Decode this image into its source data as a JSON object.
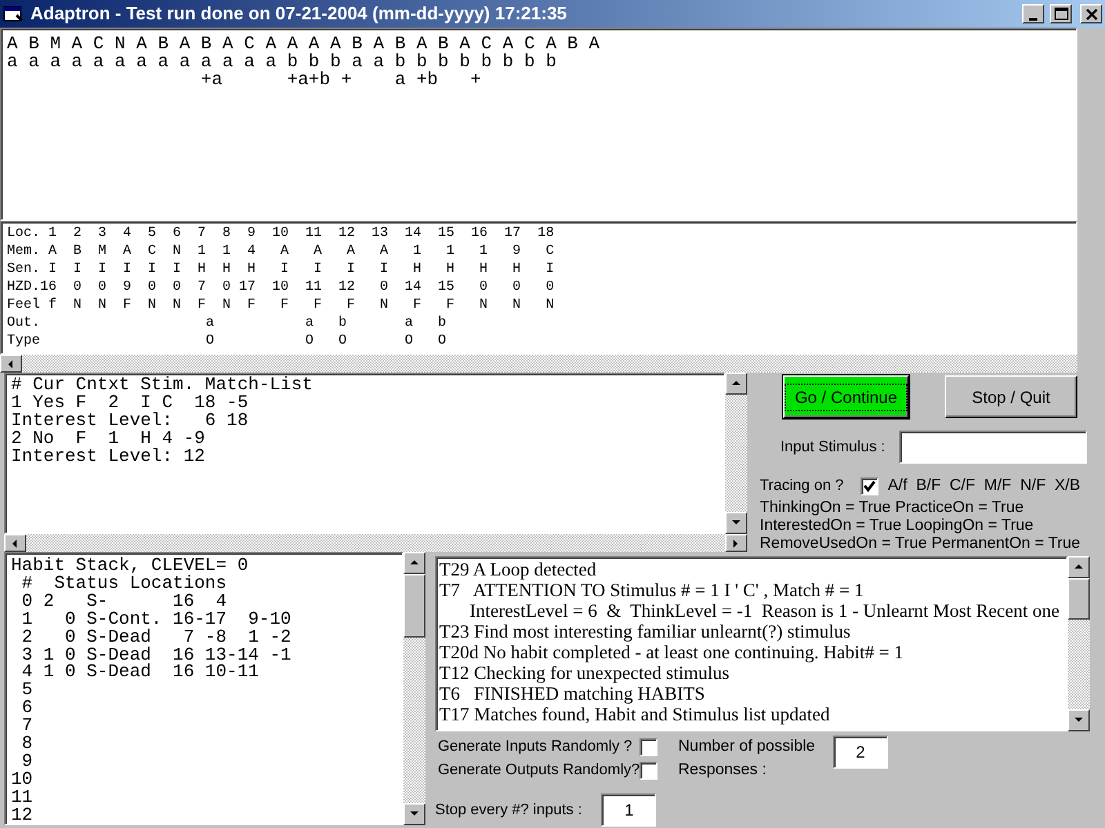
{
  "window": {
    "title": "Adaptron - Test run done on 07-21-2004 (mm-dd-yyyy) 17:21:35"
  },
  "sequence_panel": {
    "lines": [
      "A B M A C N A B A B A C A A A A B A B A B A C A C A B A",
      "a a a a a a a a a a a a a b b b a a b b b b b b b b",
      "                  +a      +a+b +    a +b   +"
    ]
  },
  "memory_panel": {
    "lines": [
      "Loc. 1  2  3  4  5  6  7  8  9  10  11  12  13  14  15  16  17  18",
      "Mem. A  B  M  A  C  N  1  1  4   A   A   A   A   1   1   1   9   C",
      "Sen. I  I  I  I  I  I  H  H  H   I   I   I   I   H   H   H   H   I",
      "HZD.16  0  0  9  0  0  7  0 17  10  11  12   0  14  15   0   0   0",
      "Feel f  N  N  F  N  N  F  N  F   F   F   F   N   F   F   N   N   N",
      "Out.                    a           a   b       a   b",
      "Type                    O           O   O       O   O"
    ]
  },
  "match_panel": {
    "lines": [
      "# Cur Cntxt Stim. Match-List",
      "1 Yes F  2  I C  18 -5",
      "Interest Level:   6 18",
      "2 No  F  1  H 4 -9",
      "Interest Level: 12"
    ]
  },
  "buttons": [
    {
      "label": "Go / Continue",
      "kind": "default"
    },
    {
      "label": "Stop / Quit",
      "kind": "normal"
    }
  ],
  "input_stimulus": {
    "label": "Input Stimulus :"
  },
  "tracing": {
    "label": "Tracing on ?",
    "checked": true,
    "codes": "A/f  B/F  C/F  M/F  N/F  X/B"
  },
  "flags": [
    "ThinkingOn = True PracticeOn = True",
    "InterestedOn = True LoopingOn = True",
    "RemoveUsedOn = True PermanentOn = True"
  ],
  "habit_panel": {
    "lines": [
      "Habit Stack, CLEVEL= 0",
      " #  Status Locations",
      " 0 2   S-      16  4",
      " 1   0 S-Cont. 16-17  9-10",
      " 2   0 S-Dead   7 -8  1 -2",
      " 3 1 0 S-Dead  16 13-14 -1",
      " 4 1 0 S-Dead  16 10-11",
      " 5",
      " 6",
      " 7",
      " 8",
      " 9",
      "10",
      "11",
      "12"
    ]
  },
  "trace_log": {
    "lines": [
      {
        "text": "T29 A Loop detected",
        "kind": "entry"
      },
      {
        "text": "T7   ATTENTION TO Stimulus # = 1 I ' C' , Match # = 1",
        "kind": "entry"
      },
      {
        "text": "InterestLevel = 6  &  ThinkLevel = -1  Reason is 1 - Unlearnt Most Recent one",
        "kind": "continuation"
      },
      {
        "text": "T23 Find most interesting familiar unlearnt(?) stimulus",
        "kind": "entry"
      },
      {
        "text": "T20d No habit completed - at least one continuing. Habit# = 1",
        "kind": "entry"
      },
      {
        "text": "T12 Checking for unexpected stimulus",
        "kind": "entry"
      },
      {
        "text": "T6   FINISHED matching HABITS",
        "kind": "entry"
      },
      {
        "text": "T17 Matches found, Habit and Stimulus list updated",
        "kind": "entry"
      }
    ]
  },
  "random_options": [
    {
      "label": "Generate Inputs Randomly ?",
      "checked": false
    },
    {
      "label": "Generate Outputs Randomly?",
      "checked": false
    }
  ],
  "responses": {
    "label": "Number of possible Responses :",
    "value": "2"
  },
  "stop_every": {
    "label": "Stop every #? inputs :",
    "value": "1"
  }
}
